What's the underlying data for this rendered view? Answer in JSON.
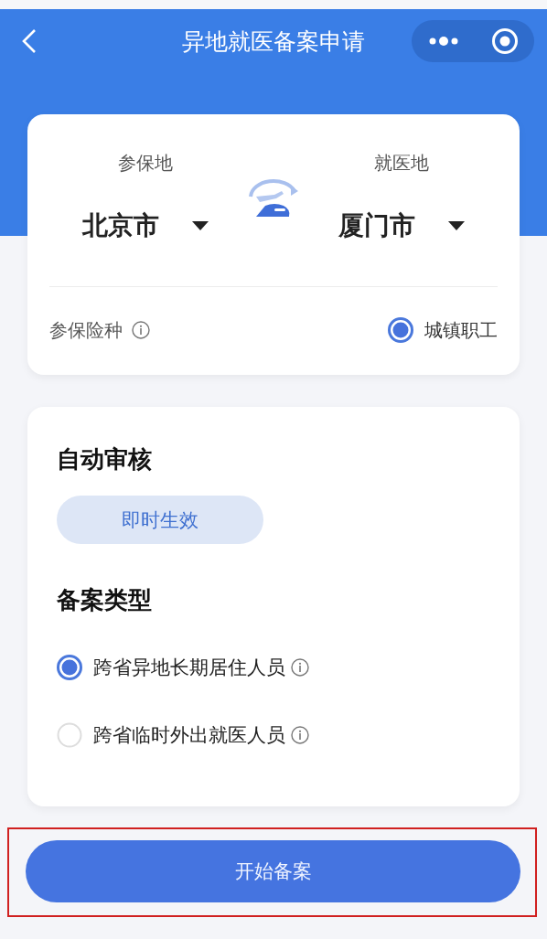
{
  "header": {
    "title": "异地就医备案申请"
  },
  "route": {
    "origin": {
      "label": "参保地",
      "value": "北京市"
    },
    "destination": {
      "label": "就医地",
      "value": "厦门市"
    }
  },
  "insurance": {
    "label": "参保险种",
    "options": [
      {
        "label": "城镇职工",
        "selected": true
      }
    ]
  },
  "auto_review": {
    "title": "自动审核",
    "tag": "即时生效"
  },
  "filing_type": {
    "title": "备案类型",
    "options": [
      {
        "label": "跨省异地长期居住人员",
        "selected": true
      },
      {
        "label": "跨省临时外出就医人员",
        "selected": false
      }
    ]
  },
  "submit": {
    "label": "开始备案",
    "highlighted": true
  }
}
